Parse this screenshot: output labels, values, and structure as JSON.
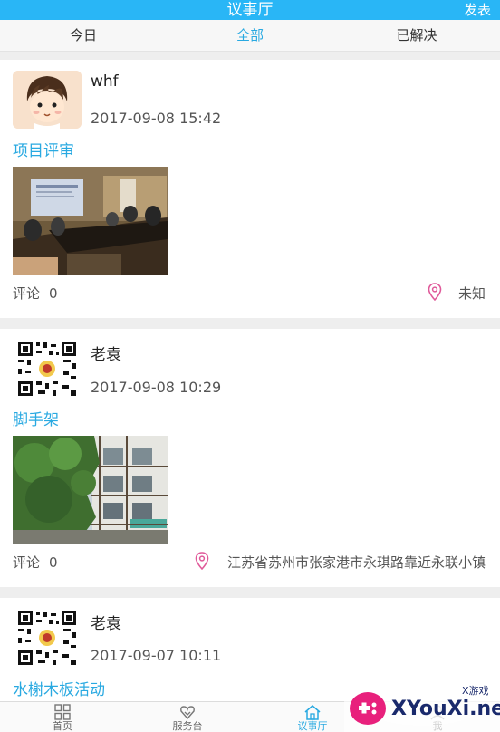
{
  "header": {
    "title": "议事厅",
    "publish_label": "发表",
    "bg_color": "#29b6f6"
  },
  "tabs": [
    {
      "label": "今日",
      "active": false
    },
    {
      "label": "全部",
      "active": true
    },
    {
      "label": "已解决",
      "active": false
    }
  ],
  "posts": [
    {
      "user": "whf",
      "time": "2017-09-08 15:42",
      "title": "项目评审",
      "comments_label": "评论",
      "comments_count": "0",
      "location": "未知",
      "avatar": "cartoon-boy-avatar",
      "photo": "meeting-room-photo"
    },
    {
      "user": "老袁",
      "time": "2017-09-08 10:29",
      "title": "脚手架",
      "comments_label": "评论",
      "comments_count": "0",
      "location": "江苏省苏州市张家港市永琪路靠近永联小镇",
      "avatar": "qr-code-avatar",
      "photo": "building-scaffold-photo"
    },
    {
      "user": "老袁",
      "time": "2017-09-07 10:11",
      "title": "水榭木板活动",
      "avatar": "qr-code-avatar"
    }
  ],
  "bottom_nav": [
    {
      "label": "首页",
      "icon": "grid-icon",
      "active": false
    },
    {
      "label": "服务台",
      "icon": "service-icon",
      "active": false
    },
    {
      "label": "议事厅",
      "icon": "home-icon",
      "active": true
    },
    {
      "label": "我",
      "icon": "user-icon",
      "active": false
    }
  ],
  "watermark": {
    "text": "XYouXi.net",
    "tag": "X游戏"
  },
  "colors": {
    "accent": "#29a9e1",
    "location_pin": "#e05a9a"
  }
}
